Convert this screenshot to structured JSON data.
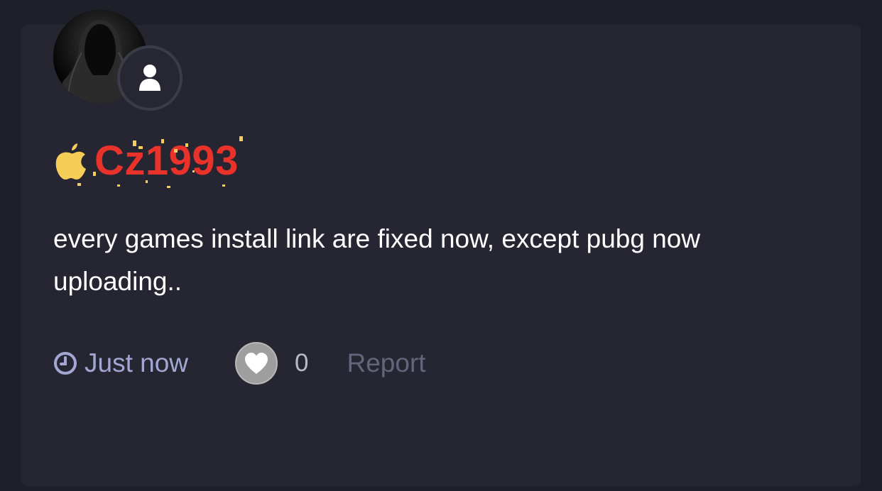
{
  "post": {
    "username": "Cz1993",
    "username_color": "#e8322a",
    "badge_icon": "apple-icon",
    "badge_color": "#f5cd57",
    "avatar_icon": "hooded-figure-avatar",
    "avatar_badge_icon": "user-icon",
    "message": "every games install link are fixed now, except pubg now uploading..",
    "time_icon": "clock-icon",
    "time": "Just now",
    "like_icon": "heart-icon",
    "like_count": "0",
    "report_label": "Report"
  }
}
